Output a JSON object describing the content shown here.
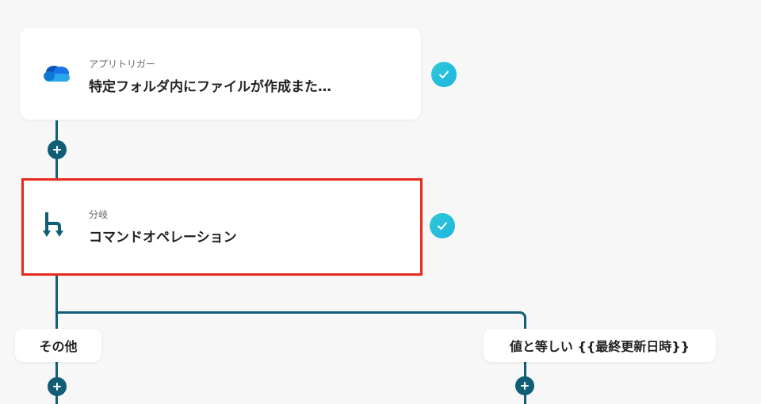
{
  "trigger": {
    "subtitle": "アプリトリガー",
    "title": "特定フォルダ内にファイルが作成また…",
    "icon": "onedrive-cloud-icon"
  },
  "branch": {
    "subtitle": "分岐",
    "title": "コマンドオペレーション",
    "icon": "branch-icon"
  },
  "branches": {
    "left_label": "その他",
    "right_label": "値と等しい {{最終更新日時}}"
  },
  "colors": {
    "line": "#0f5e76",
    "check": "#2ec9d6",
    "highlight": "#e8291c",
    "onedrive": "#1a73e8"
  }
}
